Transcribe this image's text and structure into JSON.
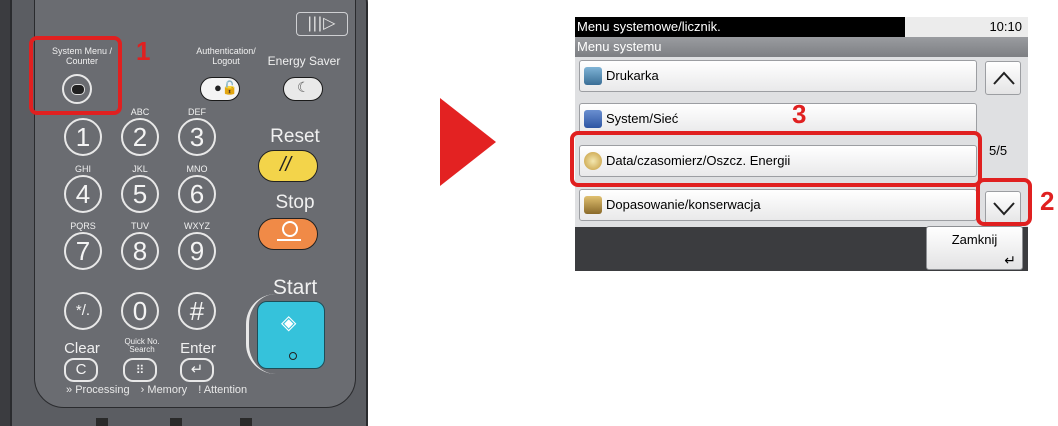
{
  "panel": {
    "system_menu_label": "System Menu /\nCounter",
    "auth_label": "Authentication/\nLogout",
    "energy_label": "Energy Saver",
    "keys": [
      {
        "num": "1",
        "sub": ""
      },
      {
        "num": "2",
        "sub": "ABC"
      },
      {
        "num": "3",
        "sub": "DEF"
      },
      {
        "num": "4",
        "sub": "GHI"
      },
      {
        "num": "5",
        "sub": "JKL"
      },
      {
        "num": "6",
        "sub": "MNO"
      },
      {
        "num": "7",
        "sub": "PQRS"
      },
      {
        "num": "8",
        "sub": "TUV"
      },
      {
        "num": "9",
        "sub": "WXYZ"
      },
      {
        "num": "*/.",
        "sub": ""
      },
      {
        "num": "0",
        "sub": ""
      },
      {
        "num": "#",
        "sub": ""
      }
    ],
    "reset_label": "Reset",
    "stop_label": "Stop",
    "start_label": "Start",
    "clear_label": "Clear",
    "quick_no_label": "Quick No.\nSearch",
    "enter_label": "Enter",
    "processing_label": "Processing",
    "memory_label": "Memory",
    "attention_label": "Attention"
  },
  "callouts": {
    "one": "1",
    "two": "2",
    "three": "3"
  },
  "screen": {
    "title": "Menu systemowe/licznik.",
    "time": "10:10",
    "subtitle": "Menu systemu",
    "items": [
      {
        "label": "Drukarka"
      },
      {
        "label": "System/Sieć"
      },
      {
        "label": "Data/czasomierz/Oszcz. Energii"
      },
      {
        "label": "Dopasowanie/konserwacja"
      }
    ],
    "page_indicator": "5/5",
    "close_label": "Zamknij"
  },
  "colors": {
    "highlight": "#e02020",
    "arrow": "#e32222",
    "reset": "#f3d44a",
    "stop": "#f08a47",
    "start": "#35c2db"
  }
}
